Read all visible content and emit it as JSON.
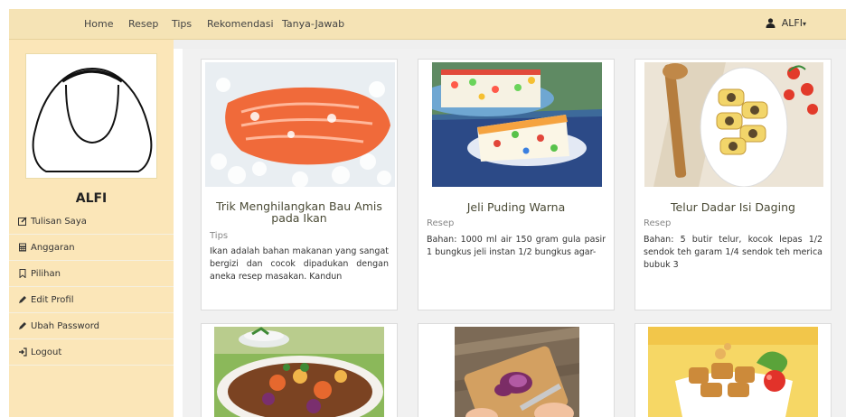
{
  "nav": {
    "items": [
      "Home",
      "Resep",
      "Tips",
      "Rekomendasi",
      "Tanya-Jawab"
    ],
    "user": "ALFI",
    "user_icon": "user-icon"
  },
  "sidebar": {
    "name": "ALFI",
    "menu": [
      {
        "label": "Tulisan Saya",
        "icon": "edit-square-icon"
      },
      {
        "label": "Anggaran",
        "icon": "calculator-icon"
      },
      {
        "label": "Pilihan",
        "icon": "bookmark-icon"
      },
      {
        "label": "Edit Profil",
        "icon": "pencil-icon"
      },
      {
        "label": "Ubah Password",
        "icon": "pencil-icon"
      },
      {
        "label": "Logout",
        "icon": "logout-icon"
      }
    ]
  },
  "cards": [
    {
      "title": "Trik Menghilangkan Bau Amis pada Ikan",
      "category": "Tips",
      "description": "Ikan adalah bahan makanan yang sangat bergizi dan cocok dipadukan dengan aneka resep masakan. Kandun",
      "image": "salmon-on-ice-image"
    },
    {
      "title": "Jeli Puding Warna",
      "category": "Resep",
      "description": "Bahan: 1000 ml air  150 gram gula pasir  1 bungkus jeli instan  1/2 bungkus agar-",
      "image": "colorful-jelly-pudding-image"
    },
    {
      "title": "Telur Dadar Isi Daging",
      "category": "Resep",
      "description": "Bahan: 5 butir telur, kocok lepas 1/2 sendok teh garam  1/4 sendok teh merica bubuk 3",
      "image": "stuffed-omelette-rolls-image"
    },
    {
      "image": "vegetable-stew-image"
    },
    {
      "image": "slicing-red-onion-image"
    },
    {
      "image": "fried-tofu-dish-image"
    }
  ]
}
